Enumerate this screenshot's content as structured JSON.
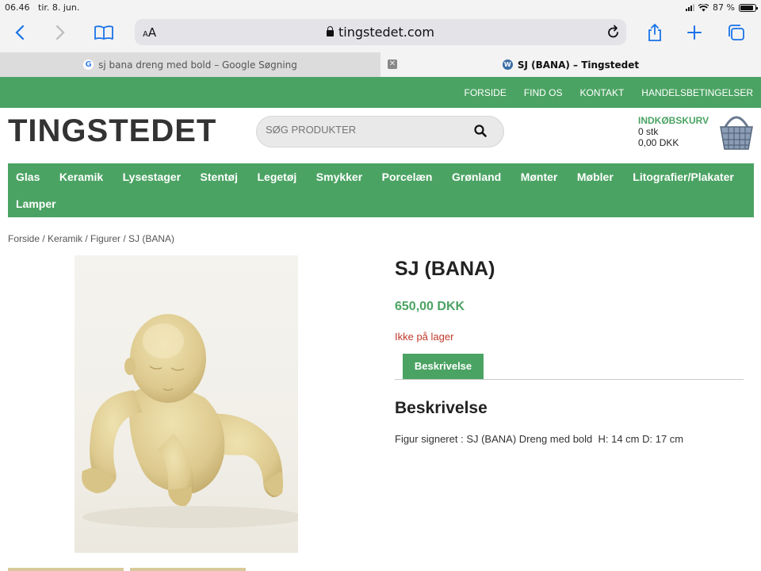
{
  "status_bar": {
    "time": "06.46",
    "date": "tir. 8. jun.",
    "battery_text": "87 %",
    "battery_level": 0.87
  },
  "browser": {
    "text_size_label": "AA",
    "url": "tingstedet.com",
    "icons": {
      "back": "chevron-left-icon",
      "forward": "chevron-right-icon",
      "bookmarks": "book-icon",
      "reload": "reload-icon",
      "share": "share-icon",
      "new_tab": "plus-icon",
      "tabs": "tabs-icon"
    },
    "tabs": [
      {
        "title": "sj bana dreng med bold – Google Søgning",
        "active": false
      },
      {
        "title": "SJ (BANA) – Tingstedet",
        "active": true
      }
    ],
    "close_glyph": "✕"
  },
  "site": {
    "brand_color": "#4ba363",
    "top_nav": [
      "FORSIDE",
      "FIND OS",
      "KONTAKT",
      "HANDELSBETINGELSER"
    ],
    "logo": "TINGSTEDET",
    "search_placeholder": "SØG PRODUKTER",
    "cart": {
      "title": "INDKØBSKURV",
      "count": "0 stk",
      "total": "0,00 DKK"
    },
    "categories": [
      "Glas",
      "Keramik",
      "Lysestager",
      "Stentøj",
      "Legetøj",
      "Smykker",
      "Porcelæn",
      "Grønland",
      "Mønter",
      "Møbler",
      "Litografier/Plakater",
      "Lamper"
    ],
    "breadcrumb": "Forside / Keramik / Figurer / SJ (BANA)"
  },
  "product": {
    "title": "SJ (BANA)",
    "price": "650,00 DKK",
    "stock": "Ikke på lager",
    "stock_color": "#c0392b",
    "tab_label": "Beskrivelse",
    "description_heading": "Beskrivelse",
    "description": "Figur signeret : SJ (BANA) Dreng med bold  H: 14 cm D: 17 cm"
  }
}
